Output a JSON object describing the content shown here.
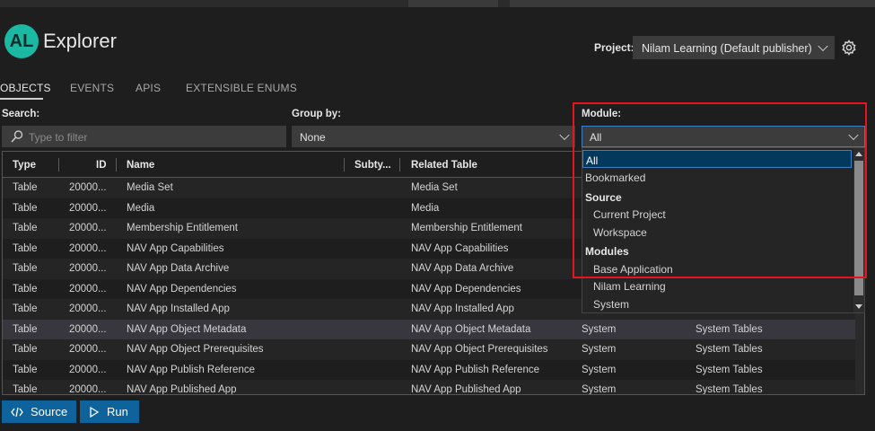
{
  "app": {
    "logo_text": "AL",
    "title": "Explorer"
  },
  "project": {
    "label": "Project:",
    "value": "Nilam Learning (Default publisher)"
  },
  "tabs": [
    {
      "label": "OBJECTS",
      "active": true
    },
    {
      "label": "EVENTS",
      "active": false
    },
    {
      "label": "APIS",
      "active": false
    },
    {
      "label": "EXTENSIBLE ENUMS",
      "active": false
    }
  ],
  "filters": {
    "search_label": "Search:",
    "search_placeholder": "Type to filter",
    "group_label": "Group by:",
    "group_value": "None",
    "module_label": "Module:",
    "module_value": "All"
  },
  "table": {
    "columns": [
      "Type",
      "ID",
      "Name",
      "Subty...",
      "Related Table"
    ],
    "rows": [
      [
        "Table",
        "20000...",
        "Media Set",
        "",
        "Media Set",
        "",
        ""
      ],
      [
        "Table",
        "20000...",
        "Media",
        "",
        "Media",
        "",
        ""
      ],
      [
        "Table",
        "20000...",
        "Membership Entitlement",
        "",
        "Membership Entitlement",
        "",
        ""
      ],
      [
        "Table",
        "20000...",
        "NAV App Capabilities",
        "",
        "NAV App Capabilities",
        "",
        ""
      ],
      [
        "Table",
        "20000...",
        "NAV App Data Archive",
        "",
        "NAV App Data Archive",
        "",
        ""
      ],
      [
        "Table",
        "20000...",
        "NAV App Dependencies",
        "",
        "NAV App Dependencies",
        "",
        ""
      ],
      [
        "Table",
        "20000...",
        "NAV App Installed App",
        "",
        "NAV App Installed App",
        "",
        ""
      ],
      [
        "Table",
        "20000...",
        "NAV App Object Metadata",
        "",
        "NAV App Object Metadata",
        "System",
        "System Tables"
      ],
      [
        "Table",
        "20000...",
        "NAV App Object Prerequisites",
        "",
        "NAV App Object Prerequisites",
        "System",
        "System Tables"
      ],
      [
        "Table",
        "20000...",
        "NAV App Publish Reference",
        "",
        "NAV App Publish Reference",
        "System",
        "System Tables"
      ],
      [
        "Table",
        "20000...",
        "NAV App Published App",
        "",
        "NAV App Published App",
        "System",
        "System Tables"
      ]
    ]
  },
  "module_dropdown": {
    "items": [
      {
        "kind": "item",
        "label": "All",
        "selected": true
      },
      {
        "kind": "item",
        "label": "Bookmarked"
      },
      {
        "kind": "header",
        "label": "Source"
      },
      {
        "kind": "sub",
        "label": "Current Project"
      },
      {
        "kind": "sub",
        "label": "Workspace"
      },
      {
        "kind": "header",
        "label": "Modules"
      },
      {
        "kind": "sub",
        "label": "Base Application"
      },
      {
        "kind": "sub",
        "label": "Nilam Learning"
      },
      {
        "kind": "sub",
        "label": "System"
      }
    ]
  },
  "buttons": {
    "source": "Source",
    "run": "Run"
  },
  "colors": {
    "accent": "#0e639c",
    "highlight": "#e8141c",
    "logo": "#1bb8a2"
  }
}
